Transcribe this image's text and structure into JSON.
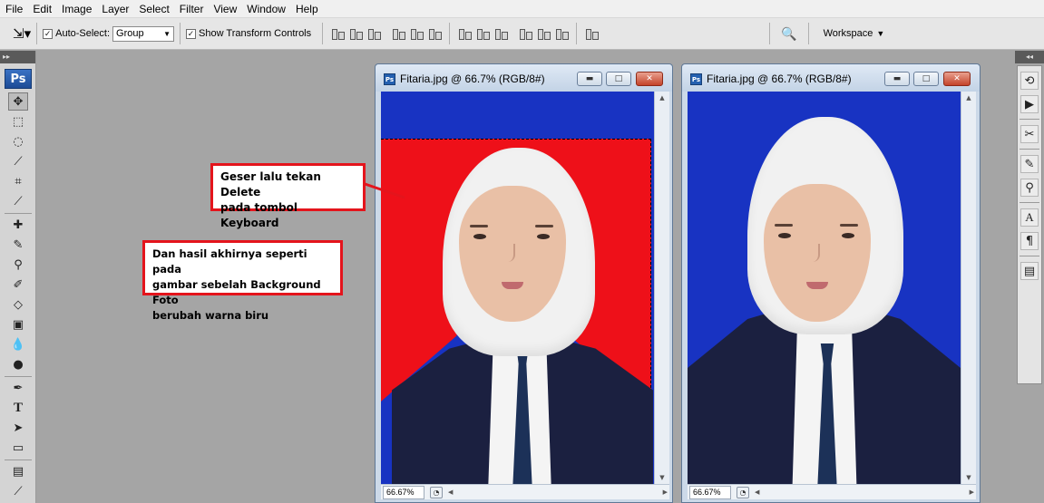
{
  "app": {
    "menu": [
      "File",
      "Edit",
      "Image",
      "Layer",
      "Select",
      "Filter",
      "View",
      "Window",
      "Help"
    ]
  },
  "options_bar": {
    "auto_select_label": "Auto-Select:",
    "auto_select_checked": true,
    "group_value": "Group",
    "show_transform_label": "Show Transform Controls",
    "show_transform_checked": true,
    "workspace_label": "Workspace"
  },
  "toolbox": {
    "logo": "Ps"
  },
  "documents": [
    {
      "title": "Fitaria.jpg @ 66.7% (RGB/8#)",
      "zoom": "66.67%"
    },
    {
      "title": "Fitaria.jpg @ 66.7% (RGB/8#)",
      "zoom": "66.67%"
    }
  ],
  "annotations": {
    "delete_note": [
      "Geser lalu tekan Delete",
      "pada tombol Keyboard"
    ],
    "result_note": [
      "Dan hasil akhirnya seperti pada",
      "gambar sebelah Background Foto",
      "berubah warna biru"
    ]
  },
  "colors": {
    "annotation_border": "#e4141c",
    "photo_red": "#ee1019",
    "photo_blue": "#1833c2"
  }
}
